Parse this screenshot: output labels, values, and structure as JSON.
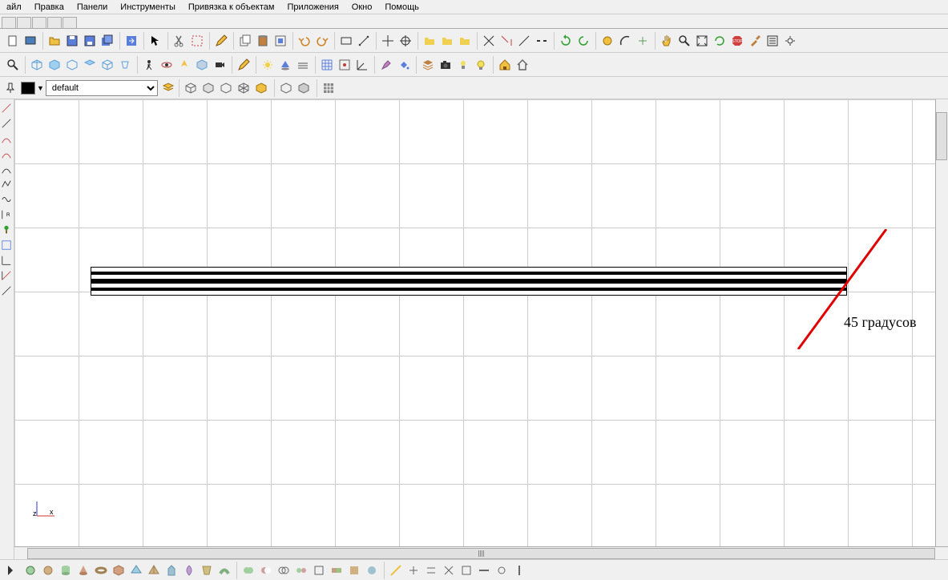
{
  "menu": {
    "items": [
      "айл",
      "Правка",
      "Панели",
      "Инструменты",
      "Привязка к объектам",
      "Приложения",
      "Окно",
      "Помощь"
    ]
  },
  "layer": {
    "selected": "default"
  },
  "canvas": {
    "annotation": "45 градусов",
    "axis_x": "x",
    "axis_z": "z"
  }
}
